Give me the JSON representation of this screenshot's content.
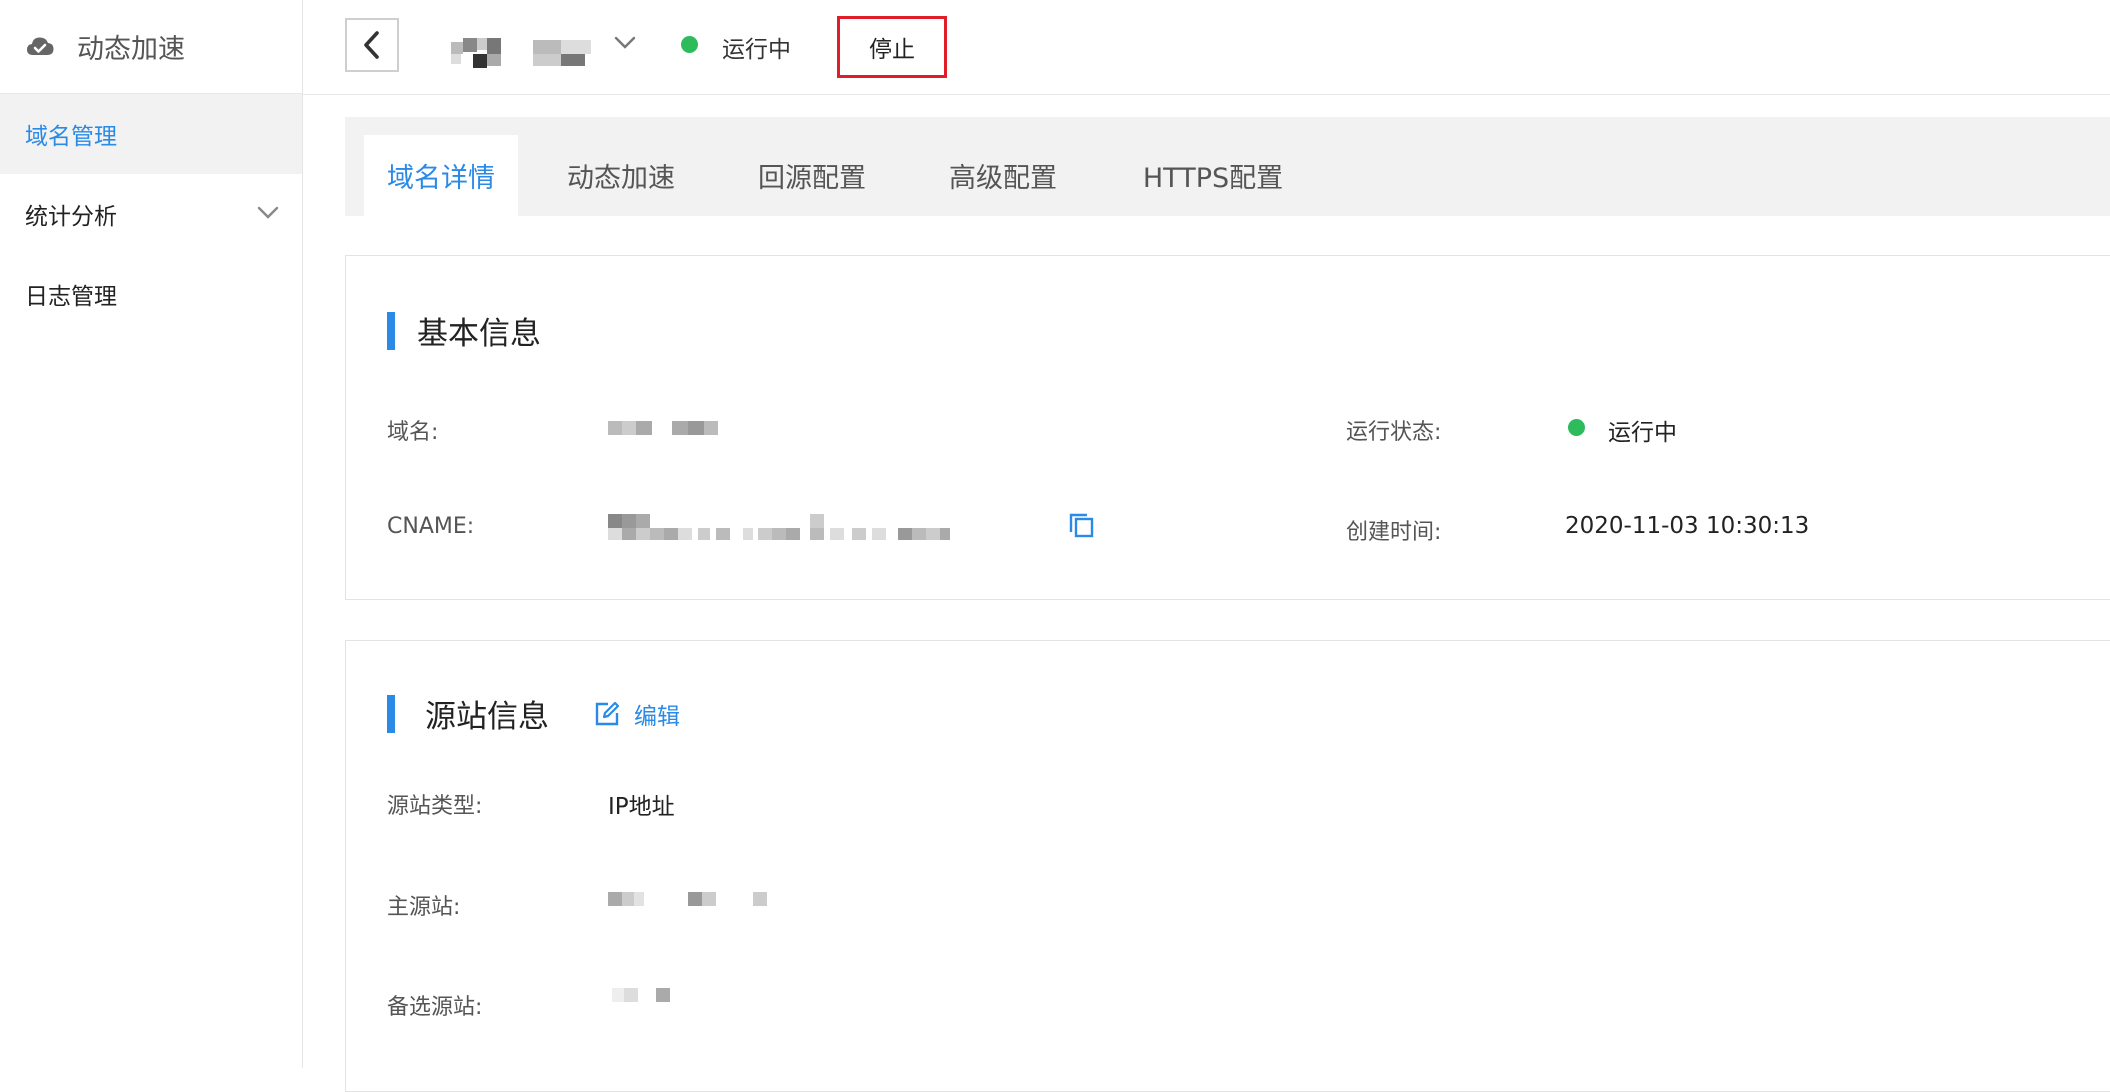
{
  "sidebar": {
    "title": "动态加速",
    "items": [
      {
        "label": "域名管理",
        "active": true
      },
      {
        "label": "统计分析",
        "expandable": true
      },
      {
        "label": "日志管理"
      }
    ]
  },
  "topbar": {
    "status": "运行中",
    "stop_label": "停止"
  },
  "tabs": [
    "域名详情",
    "动态加速",
    "回源配置",
    "高级配置",
    "HTTPS配置"
  ],
  "basic": {
    "title": "基本信息",
    "domain_label": "域名:",
    "cname_label": "CNAME:",
    "status_label": "运行状态:",
    "status_value": "运行中",
    "created_label": "创建时间:",
    "created_value": "2020-11-03 10:30:13"
  },
  "origin": {
    "title": "源站信息",
    "edit_label": "编辑",
    "type_label": "源站类型:",
    "type_value": "IP地址",
    "primary_label": "主源站:",
    "backup_label": "备选源站:"
  },
  "colors": {
    "accent": "#2a8ae6",
    "running": "#2dbb5c",
    "highlight": "#e11d2a"
  }
}
